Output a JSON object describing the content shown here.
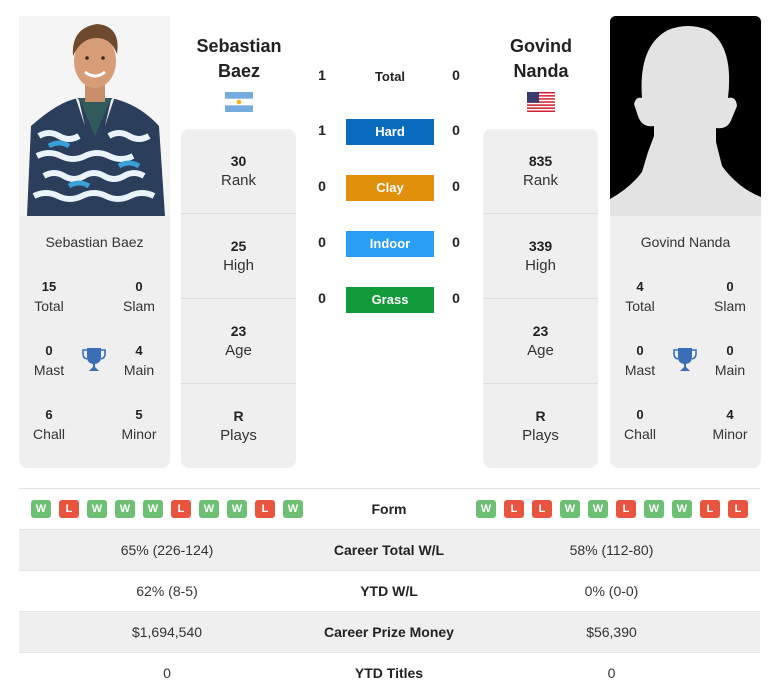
{
  "player1": {
    "name_line1": "Sebastian",
    "name_line2": "Baez",
    "full_name": "Sebastian Baez",
    "country_flag": "argentina-flag",
    "rank": "30",
    "rank_label": "Rank",
    "high": "25",
    "high_label": "High",
    "age": "23",
    "age_label": "Age",
    "plays": "R",
    "plays_label": "Plays",
    "titles": {
      "total": "15",
      "total_label": "Total",
      "slam": "0",
      "slam_label": "Slam",
      "mast": "0",
      "mast_label": "Mast",
      "main": "4",
      "main_label": "Main",
      "chall": "6",
      "chall_label": "Chall",
      "minor": "5",
      "minor_label": "Minor"
    },
    "form": [
      "W",
      "L",
      "W",
      "W",
      "W",
      "L",
      "W",
      "W",
      "L",
      "W"
    ],
    "career_wl": "65% (226-124)",
    "ytd_wl": "62% (8-5)",
    "prize_money": "$1,694,540",
    "ytd_titles": "0"
  },
  "player2": {
    "name_line1": "Govind",
    "name_line2": "Nanda",
    "full_name": "Govind Nanda",
    "country_flag": "usa-flag",
    "rank": "835",
    "rank_label": "Rank",
    "high": "339",
    "high_label": "High",
    "age": "23",
    "age_label": "Age",
    "plays": "R",
    "plays_label": "Plays",
    "titles": {
      "total": "4",
      "total_label": "Total",
      "slam": "0",
      "slam_label": "Slam",
      "mast": "0",
      "mast_label": "Mast",
      "main": "0",
      "main_label": "Main",
      "chall": "0",
      "chall_label": "Chall",
      "minor": "4",
      "minor_label": "Minor"
    },
    "form": [
      "W",
      "L",
      "L",
      "W",
      "W",
      "L",
      "W",
      "W",
      "L",
      "L"
    ],
    "career_wl": "58% (112-80)",
    "ytd_wl": "0% (0-0)",
    "prize_money": "$56,390",
    "ytd_titles": "0"
  },
  "h2h": [
    {
      "label": "Total",
      "left": "1",
      "right": "0",
      "color": null
    },
    {
      "label": "Hard",
      "left": "1",
      "right": "0",
      "color": "#0b6cbf"
    },
    {
      "label": "Clay",
      "left": "0",
      "right": "0",
      "color": "#e0900b"
    },
    {
      "label": "Indoor",
      "left": "0",
      "right": "0",
      "color": "#2a9df4"
    },
    {
      "label": "Grass",
      "left": "0",
      "right": "0",
      "color": "#139a3a"
    }
  ],
  "table_labels": {
    "form": "Form",
    "career_wl": "Career Total W/L",
    "ytd_wl": "YTD W/L",
    "prize_money": "Career Prize Money",
    "ytd_titles": "YTD Titles"
  },
  "colors": {
    "win": "#6cbf73",
    "loss": "#e8543e",
    "trophy": "#3a6fb8"
  }
}
